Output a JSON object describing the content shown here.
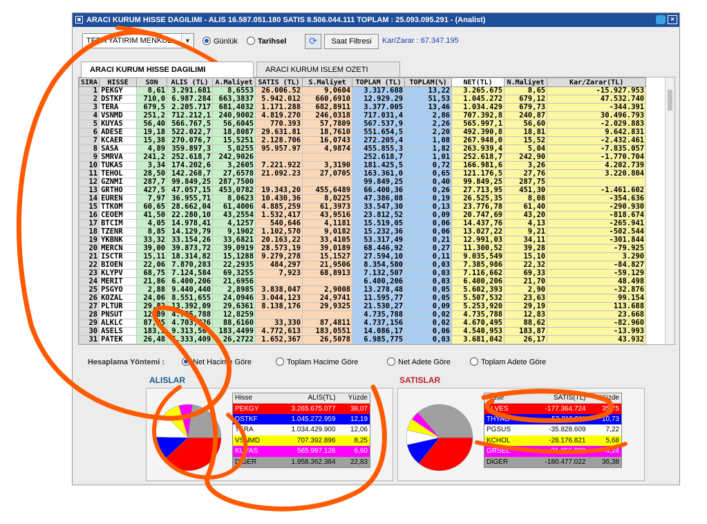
{
  "window": {
    "title": "ARACI KURUM HISSE DAGILIMI - ALIS 16.587.051.180  SATIS 8.506.044.111  TOPLAM : 25.093.095.291 - (Analist)"
  },
  "toolbar": {
    "broker": "TERA YATIRIM MENKUL",
    "radio_daily": "Günlük",
    "radio_historical": "Tarihsel",
    "hour_filter": "Saat Filtresi",
    "profit_loss": "Kar/Zarar : 67.347.195"
  },
  "tabs": [
    "ARACI KURUM HISSE DAGILIMI",
    "ARACI KURUM ISLEM OZETI"
  ],
  "table": {
    "headers": [
      "SIRA",
      "HISSE",
      "SON",
      "ALIS (TL)",
      "A.Maliyet",
      "SATIS (TL)",
      "S.Maliyet",
      "TOPLAM (TL)",
      "TOPLAM(%)",
      "NET(TL)",
      "N.Maliyet",
      "Kar/Zarar(TL)"
    ],
    "rows": [
      [
        "1",
        "PEKGY",
        "8,61",
        "3.291.681",
        "8,6553",
        "26.006.52",
        "9,0604",
        "3.317.688",
        "13,22",
        "3.265.675",
        "8,65",
        "-15.927.953"
      ],
      [
        "2",
        "DSTKF",
        "710,0",
        "6.987.284",
        "663,3837",
        "5.942.012",
        "660,6910",
        "12.929.29",
        "51,53",
        "1.045.272",
        "679,12",
        "47.532.740"
      ],
      [
        "3",
        "TERA",
        "679,5",
        "2.205.717",
        "681,4032",
        "1.171.288",
        "682,8911",
        "3.377.005",
        "13,46",
        "1.034.429",
        "679,73",
        "-344.391"
      ],
      [
        "4",
        "VSNMD",
        "251,2",
        "712.212,1",
        "240,9002",
        "4.819.270",
        "246,0318",
        "717.031,4",
        "2,86",
        "707.392,8",
        "240,87",
        "30.496.793"
      ],
      [
        "5",
        "KUYAS",
        "56,40",
        "566.767,5",
        "56,6045",
        "770.393",
        "57,7809",
        "567.537,9",
        "2,26",
        "565.997,1",
        "56,60",
        "-2.029.883"
      ],
      [
        "6",
        "ADESE",
        "19,18",
        "522.022,7",
        "18,8087",
        "29.631.81",
        "18,7610",
        "551.654,5",
        "2,20",
        "492.390,8",
        "18,81",
        "9.642.831"
      ],
      [
        "7",
        "KCAER",
        "15,38",
        "270.076,7",
        "15,5251",
        "2.128.706",
        "16,0743",
        "272.205,4",
        "1,08",
        "267.948,0",
        "15,52",
        "-2.432.461"
      ],
      [
        "8",
        "SASA",
        "4,89",
        "359.897,3",
        "5,0255",
        "95.957.97",
        "4,9874",
        "455.855,3",
        "1,82",
        "263.939,4",
        "5,04",
        "-7.835.057"
      ],
      [
        "9",
        "SMRVA",
        "241,2",
        "252.618,7",
        "242,9026",
        "",
        "",
        "252.618,7",
        "1,01",
        "252.618,7",
        "242,90",
        "-1.770.704"
      ],
      [
        "10",
        "TUKAS",
        "3,34",
        "174.202,6",
        "3,2605",
        "7.221.922",
        "3,3190",
        "181.425,5",
        "0,72",
        "166.981,6",
        "3,26",
        "4.202.739"
      ],
      [
        "11",
        "TEHOL",
        "28,50",
        "142.268,7",
        "27,6578",
        "21.092.23",
        "27,0705",
        "163.361,0",
        "0,65",
        "121.176,5",
        "27,76",
        "3.220.804"
      ],
      [
        "12",
        "GZNMI",
        "287,7",
        "99.849,25",
        "287,7500",
        "",
        "",
        "99.849,25",
        "0,40",
        "99.849,25",
        "287,75",
        ""
      ],
      [
        "13",
        "GRTHO",
        "427,5",
        "47.057,15",
        "453,0782",
        "19.343,20",
        "455,6489",
        "66.400,36",
        "0,26",
        "27.713,95",
        "451,30",
        "-1.461.602"
      ],
      [
        "14",
        "EUREN",
        "7,97",
        "36.955,71",
        "8,0623",
        "10.430,36",
        "8,0225",
        "47.386,08",
        "0,19",
        "26.525,35",
        "8,08",
        "-354.636"
      ],
      [
        "15",
        "TTKOM",
        "60,65",
        "28.662,04",
        "61,4006",
        "4.885,259",
        "61,3973",
        "33.547,30",
        "0,13",
        "23.776,78",
        "61,40",
        "-290.930"
      ],
      [
        "16",
        "CEOEM",
        "41,50",
        "22.280,10",
        "43,2554",
        "1.532,417",
        "43,9516",
        "23.812,52",
        "0,09",
        "20.747,69",
        "43,20",
        "-818.674"
      ],
      [
        "17",
        "BTCIM",
        "4,05",
        "14.978,41",
        "4,1257",
        "540,646",
        "4,1181",
        "15.519,05",
        "0,06",
        "14.437,76",
        "4,13",
        "-265.941"
      ],
      [
        "18",
        "TZENR",
        "8,85",
        "14.129,79",
        "9,1902",
        "1.102,570",
        "9,0182",
        "15.232,36",
        "0,06",
        "13.027,22",
        "9,21",
        "-502.544"
      ],
      [
        "19",
        "YKBNK",
        "33,32",
        "33.154,26",
        "33,6821",
        "20.163,22",
        "33,4105",
        "53.317,49",
        "0,21",
        "12.991,03",
        "34,11",
        "-301.844"
      ],
      [
        "20",
        "MERCN",
        "39,00",
        "39.873,72",
        "39,0919",
        "28.573,19",
        "39,0189",
        "68.446,92",
        "0,27",
        "11.300,52",
        "39,28",
        "-79.925"
      ],
      [
        "21",
        "ISCTR",
        "15,11",
        "18.314,82",
        "15,1288",
        "9.279,278",
        "15,1527",
        "27.594,10",
        "0,11",
        "9.035,549",
        "15,10",
        "3.290"
      ],
      [
        "22",
        "BIOEN",
        "22,06",
        "7.870,283",
        "22,2935",
        "484,297",
        "21,9506",
        "8.354,580",
        "0,03",
        "7.385,986",
        "22,32",
        "-84.827"
      ],
      [
        "23",
        "KLYPV",
        "68,75",
        "7.124,584",
        "69,3255",
        "7,923",
        "68,8913",
        "7.132,507",
        "0,03",
        "7.116,662",
        "69,33",
        "-59.129"
      ],
      [
        "24",
        "MERIT",
        "21,86",
        "6.400,206",
        "21,6956",
        "",
        "",
        "6.400,206",
        "0,03",
        "6.400,206",
        "21,70",
        "48.498"
      ],
      [
        "25",
        "PSGYO",
        "2,88",
        "9.440,440",
        "2,8985",
        "3.838,047",
        "2,9008",
        "13.278,48",
        "0,05",
        "5.602,393",
        "2,90",
        "-32.876"
      ],
      [
        "26",
        "KOZAL",
        "24,06",
        "8.551,655",
        "24,0946",
        "3.044,123",
        "24,9741",
        "11.595,77",
        "0,05",
        "5.507,532",
        "23,63",
        "99.154"
      ],
      [
        "27",
        "PLTUR",
        "29,82",
        "13.392,09",
        "29,6361",
        "8.138,176",
        "29,9325",
        "21.530,27",
        "0,09",
        "5.253,920",
        "29,19",
        "113.688"
      ],
      [
        "28",
        "PNSUT",
        "12,89",
        "4.735,788",
        "12,8259",
        "",
        "",
        "4.735,788",
        "0,02",
        "4.735,788",
        "12,83",
        "23.668"
      ],
      [
        "29",
        "ALKLC",
        "87,05",
        "4.703,826",
        "88,6160",
        "33,330",
        "87,4811",
        "4.737,156",
        "0,02",
        "4.670,495",
        "88,62",
        "-82.960"
      ],
      [
        "30",
        "ASELS",
        "183,3",
        "9.313,566",
        "183,4499",
        "4.772,613",
        "183,0551",
        "14.086,17",
        "0,06",
        "4.540,953",
        "183,87",
        "-13.993"
      ],
      [
        "31",
        "PATEK",
        "26,48",
        "5.333,409",
        "26,2722",
        "1.652,367",
        "26,5078",
        "6.985,775",
        "0,03",
        "3.681,042",
        "26,17",
        "43.932"
      ]
    ]
  },
  "calc": {
    "label": "Hesaplama Yöntemi :",
    "options": [
      "Net Hacime Göre",
      "Toplam Hacime Göre",
      "Net Adete Göre",
      "Toplam Adete Göre"
    ],
    "selected_index": 0
  },
  "buys": {
    "title": "ALISLAR",
    "headers": [
      "Hisse",
      "ALIS(TL)",
      "Yüzde"
    ],
    "rows": [
      {
        "name": "PEKGY",
        "value": "3.265.675.077",
        "pct": "38,07",
        "color": "#ff0000",
        "text": "#ffffff"
      },
      {
        "name": "DSTKF",
        "value": "1.045.272.959",
        "pct": "12,19",
        "color": "#0000ff",
        "text": "#ffffff"
      },
      {
        "name": "TERA",
        "value": "1.034.429.900",
        "pct": "12,06",
        "color": "#ffffff",
        "text": "#000000"
      },
      {
        "name": "VSNMD",
        "value": "707.392.896",
        "pct": "8,25",
        "color": "#ffff00",
        "text": "#000000"
      },
      {
        "name": "KUYAS",
        "value": "565.997.126",
        "pct": "6,60",
        "color": "#ff00ff",
        "text": "#ffffff"
      },
      {
        "name": "DiGER",
        "value": "1.958.362.384",
        "pct": "22,83",
        "color": "#a0a0a0",
        "text": "#000000"
      }
    ]
  },
  "sells": {
    "title": "SATISLAR",
    "headers": [
      "Hisse",
      "SATIS(TL)",
      "Yüzde"
    ],
    "rows": [
      {
        "name": "ALVES",
        "value": "-177.364.724",
        "pct": "35,75",
        "color": "#ff0000",
        "text": "#ffffff"
      },
      {
        "name": "THYAO",
        "value": "-53.219.211",
        "pct": "10,73",
        "color": "#0000ff",
        "text": "#ffffff"
      },
      {
        "name": "PGSUS",
        "value": "-35.828.609",
        "pct": "7,22",
        "color": "#ffffff",
        "text": "#000000"
      },
      {
        "name": "KCHOL",
        "value": "-28.176.821",
        "pct": "5,68",
        "color": "#ffff00",
        "text": "#000000"
      },
      {
        "name": "GRSEL",
        "value": "-21.056.888",
        "pct": "4,24",
        "color": "#ff00ff",
        "text": "#ffffff"
      },
      {
        "name": "DiGER",
        "value": "-180.477.022",
        "pct": "36,38",
        "color": "#a0a0a0",
        "text": "#000000"
      }
    ]
  },
  "colors": {
    "titlebar": "#1e4f9a",
    "annotation": "#ff5a00"
  }
}
